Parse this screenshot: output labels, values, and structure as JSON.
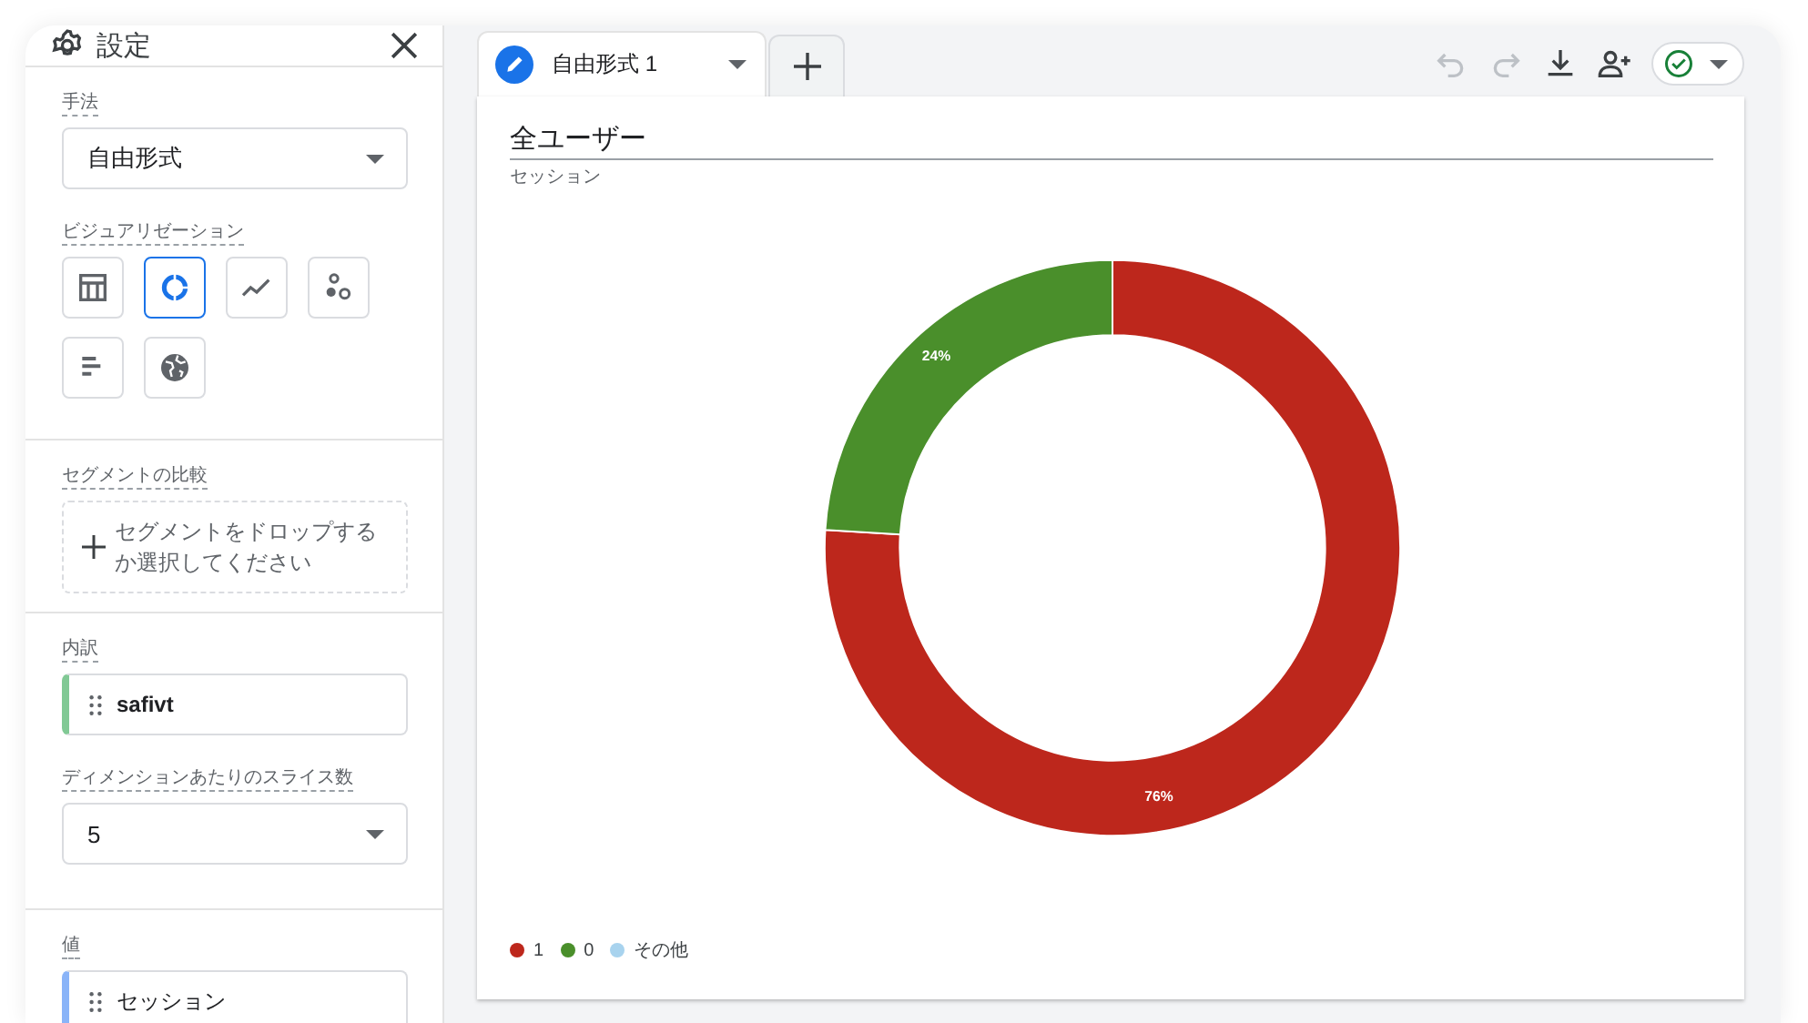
{
  "settings": {
    "title": "設定",
    "technique": {
      "label": "手法",
      "value": "自由形式"
    },
    "visualization": {
      "label": "ビジュアリゼーション",
      "options": [
        {
          "kind": "table",
          "selected": false
        },
        {
          "kind": "donut",
          "selected": true
        },
        {
          "kind": "line",
          "selected": false
        },
        {
          "kind": "scatter",
          "selected": false
        },
        {
          "kind": "bar",
          "selected": false
        },
        {
          "kind": "geo",
          "selected": false
        }
      ]
    },
    "segment_compare": {
      "label": "セグメントの比較",
      "placeholder": "セグメントをドロップするか選択してください"
    },
    "breakdown": {
      "label": "内訳",
      "item": "safivt",
      "color": "#81c995"
    },
    "slices": {
      "label": "ディメンションあたりのスライス数",
      "value": "5"
    },
    "values": {
      "label": "値",
      "item": "セッション",
      "color": "#8ab4f8"
    }
  },
  "tabs": [
    {
      "label": "自由形式 1",
      "selected": true
    }
  ],
  "toolbar": [
    {
      "kind": "undo",
      "disabled": true
    },
    {
      "kind": "redo",
      "disabled": true
    },
    {
      "kind": "download",
      "disabled": false
    },
    {
      "kind": "share",
      "disabled": false
    },
    {
      "kind": "status",
      "disabled": false
    }
  ],
  "card": {
    "title": "全ユーザー",
    "chart_data": {
      "type": "donut",
      "categories": [
        "1",
        "0",
        "その他"
      ],
      "series": [
        {
          "name": "セッション",
          "values": [
            76,
            24,
            0
          ]
        }
      ],
      "value_labels": [
        "76%",
        "24%",
        null
      ]
    },
    "legend": [
      {
        "color": "#bd271c"
      },
      {
        "color": "#4a8f2b"
      },
      {
        "color": "#a8d3ee"
      }
    ]
  }
}
